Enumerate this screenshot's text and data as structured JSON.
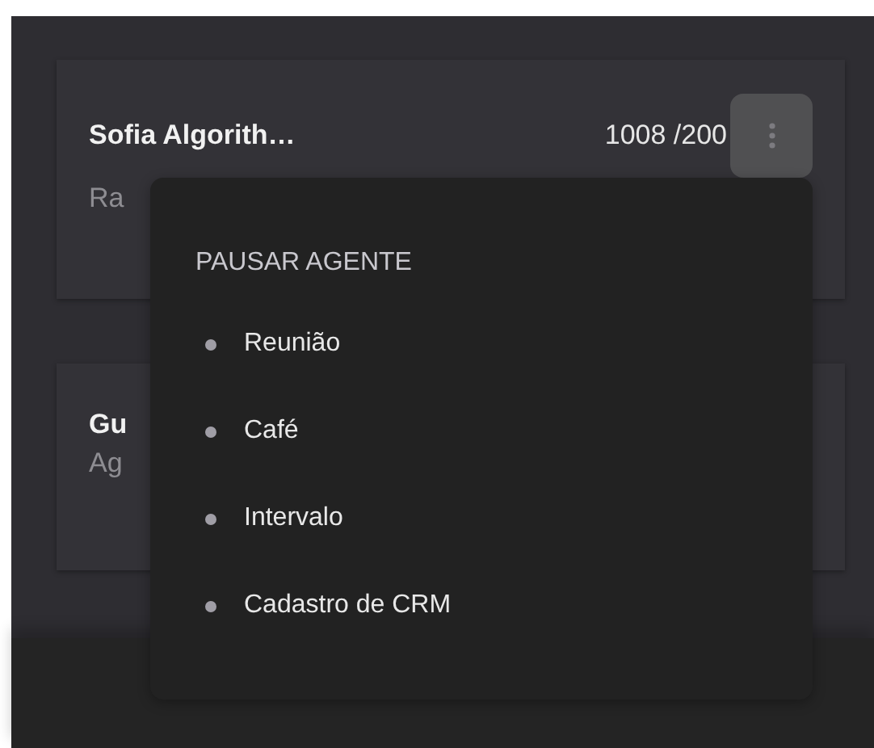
{
  "cards": [
    {
      "name": "Sofia Algorith…",
      "count": "1008 /200",
      "subtitle": "Ra",
      "has_menu_button": true
    },
    {
      "name": "Gu",
      "subtitle": "Ag",
      "has_menu_button": false
    }
  ],
  "menu": {
    "heading": "PAUSAR AGENTE",
    "items": [
      {
        "label": "Reunião"
      },
      {
        "label": "Café"
      },
      {
        "label": "Intervalo"
      },
      {
        "label": "Cadastro de CRM"
      }
    ]
  }
}
